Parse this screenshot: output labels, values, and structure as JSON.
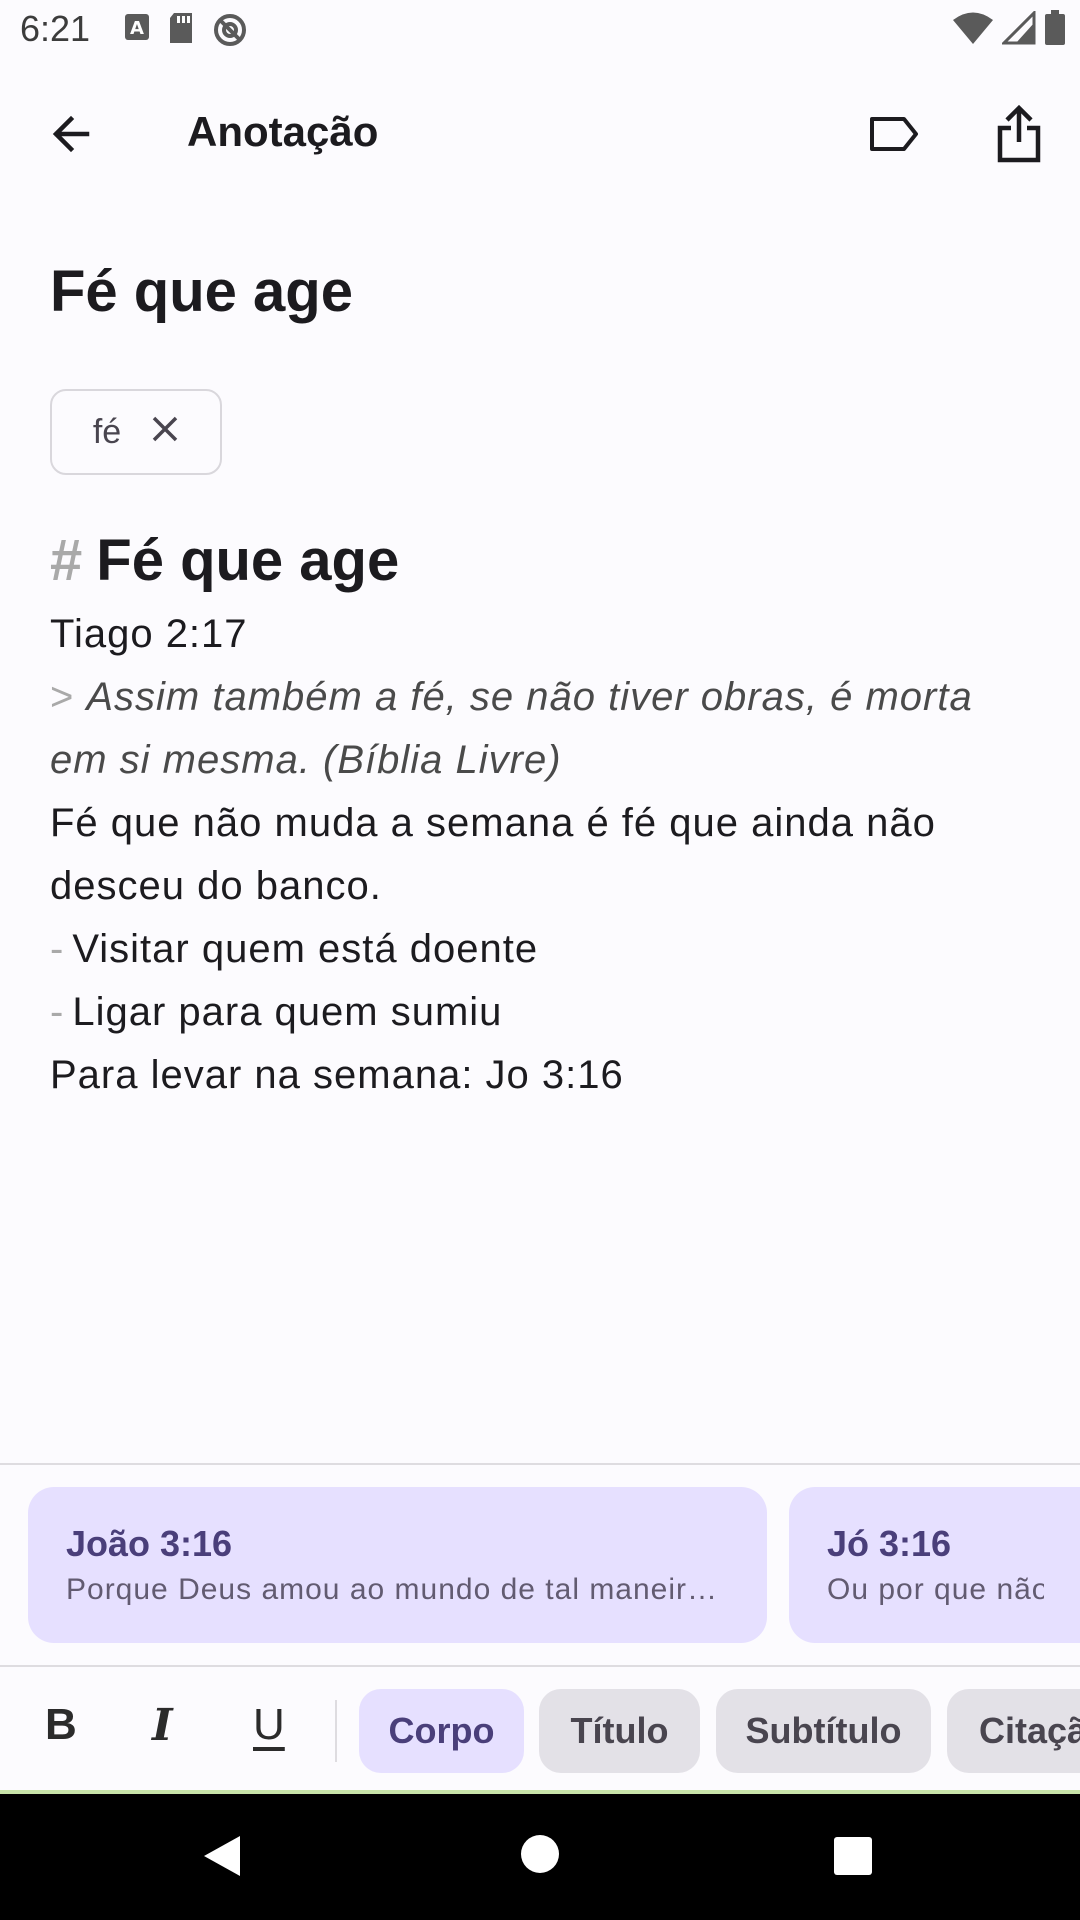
{
  "status_bar": {
    "time": "6:21",
    "left_icons": [
      "text-a-icon",
      "sd-card-icon",
      "no-sync-icon"
    ],
    "right_icons": [
      "wifi-icon",
      "signal-icon",
      "battery-icon"
    ]
  },
  "app_bar": {
    "title": "Anotação",
    "icons": [
      "back-arrow-icon",
      "label-icon",
      "share-icon"
    ]
  },
  "note": {
    "title": "Fé que age",
    "tags": [
      {
        "label": "fé"
      }
    ],
    "content": {
      "heading_marker": "#",
      "heading": "Fé que age",
      "reference": "Tiago 2:17",
      "quote_marker": ">",
      "quote_line1": "Assim também a fé, se não tiver obras, é morta",
      "quote_line2": "em si mesma. (Bíblia Livre)",
      "para_line1": "Fé que não muda a semana é fé que ainda não",
      "para_line2": "desceu do banco.",
      "list_marker": "-",
      "list_item1": "Visitar quem está doente",
      "list_item2": "Ligar para quem sumiu",
      "closing": "Para levar na semana: Jo 3:16"
    }
  },
  "verse_suggestions": [
    {
      "title": "João 3:16",
      "text": "Porque Deus amou ao mundo de tal maneira que deu o seu Filho"
    },
    {
      "title": "Jó 3:16",
      "text": "Ou por que não fui"
    }
  ],
  "toolbar": {
    "bold": "B",
    "italic": "I",
    "underline": "U",
    "styles": [
      {
        "label": "Corpo",
        "active": true
      },
      {
        "label": "Título",
        "active": false
      },
      {
        "label": "Subtítulo",
        "active": false
      },
      {
        "label": "Citação",
        "active": false
      }
    ]
  },
  "colors": {
    "accent_container": "#e6e0ff",
    "accent_text": "#4a3f7a",
    "background": "#fcfbfe"
  }
}
